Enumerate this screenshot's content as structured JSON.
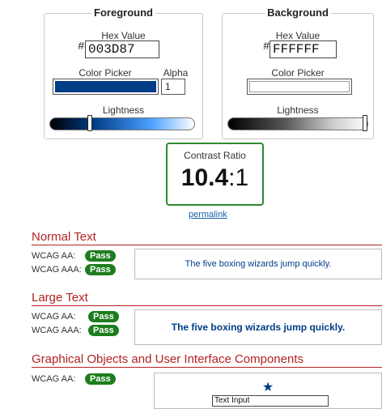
{
  "foreground": {
    "title": "Foreground",
    "hex_label": "Hex Value",
    "hash": "#",
    "hex": "003D87",
    "picker_label": "Color Picker",
    "alpha_label": "Alpha",
    "alpha": "1",
    "lightness_label": "Lightness",
    "lightness": 0.27,
    "color": "#003D87"
  },
  "background": {
    "title": "Background",
    "hex_label": "Hex Value",
    "hash": "#",
    "hex": "FFFFFF",
    "picker_label": "Color Picker",
    "lightness_label": "Lightness",
    "lightness": 1.0,
    "color": "#FFFFFF"
  },
  "contrast": {
    "title": "Contrast Ratio",
    "value_bold": "10.4",
    "value_rest": ":1",
    "permalink": "permalink"
  },
  "normal_text": {
    "heading": "Normal Text",
    "aa_label": "WCAG AA:",
    "aa_result": "Pass",
    "aaa_label": "WCAG AAA:",
    "aaa_result": "Pass",
    "sample": "The five boxing wizards jump quickly."
  },
  "large_text": {
    "heading": "Large Text",
    "aa_label": "WCAG AA:",
    "aa_result": "Pass",
    "aaa_label": "WCAG AAA:",
    "aaa_result": "Pass",
    "sample": "The five boxing wizards jump quickly."
  },
  "graphical": {
    "heading": "Graphical Objects and User Interface Components",
    "aa_label": "WCAG AA:",
    "aa_result": "Pass",
    "star": "★",
    "input_value": "Text Input"
  },
  "colors": {
    "pass_green": "#1E7D1E",
    "heading_red": "#B22222",
    "link_blue": "#1A5EA8"
  }
}
